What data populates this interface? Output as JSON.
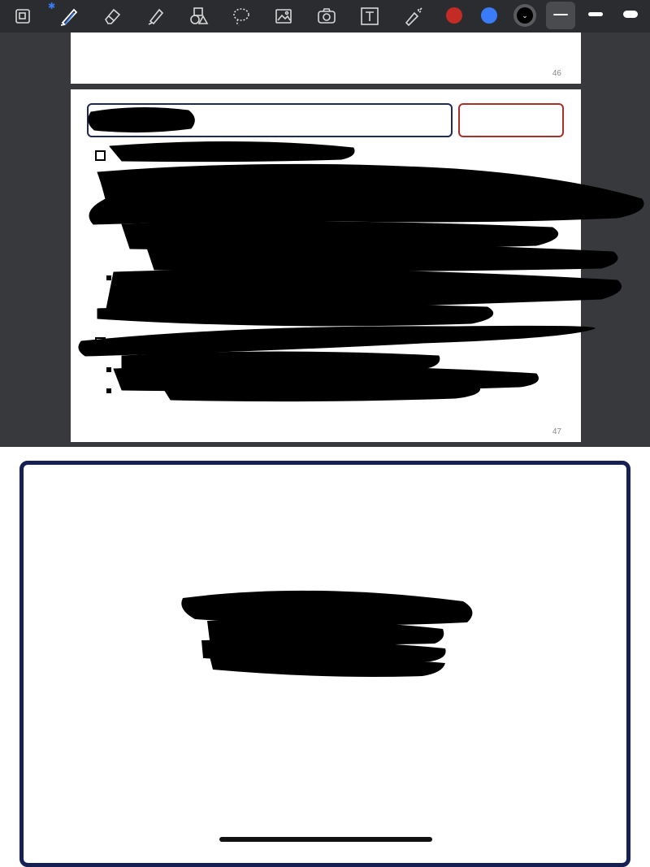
{
  "toolbar": {
    "tools": [
      {
        "name": "pages-icon"
      },
      {
        "name": "pen-icon"
      },
      {
        "name": "eraser-icon"
      },
      {
        "name": "highlighter-icon"
      },
      {
        "name": "shapes-icon"
      },
      {
        "name": "lasso-icon"
      },
      {
        "name": "image-icon"
      },
      {
        "name": "camera-icon"
      },
      {
        "name": "text-icon"
      },
      {
        "name": "laser-pointer-icon"
      }
    ],
    "colors": [
      "#c42b24",
      "#3a7bf7"
    ],
    "selected_stroke": "thin",
    "bluetooth_icon": "bluetooth-icon"
  },
  "document": {
    "pages": [
      {
        "page_number": "46"
      },
      {
        "page_number": "47"
      }
    ]
  }
}
